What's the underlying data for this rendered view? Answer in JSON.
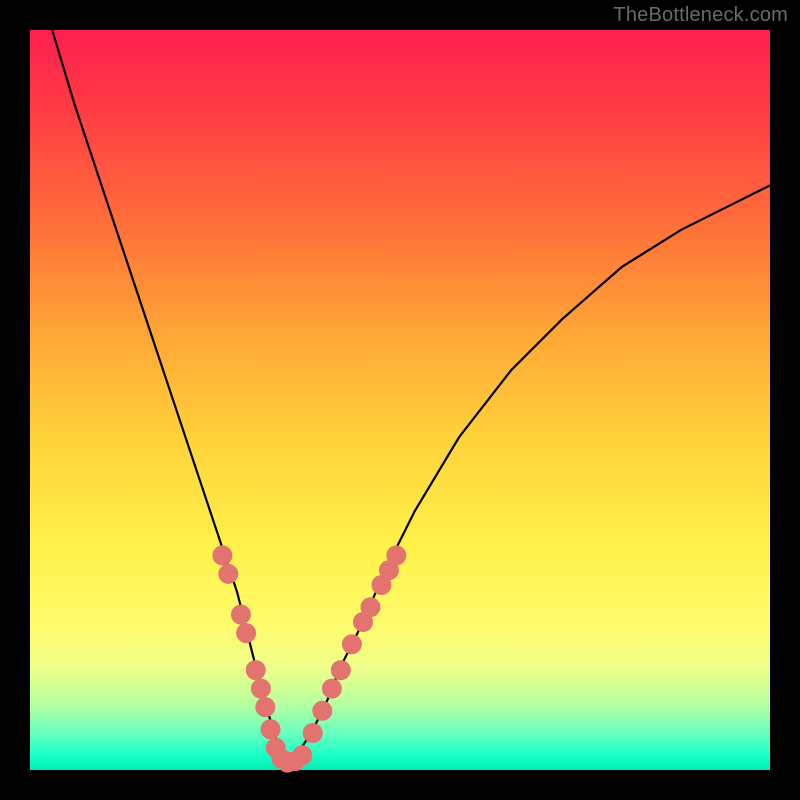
{
  "watermark": "TheBottleneck.com",
  "colors": {
    "marker": "#e2736f",
    "curve": "#000000",
    "frame": "#000000"
  },
  "chart_data": {
    "type": "line",
    "title": "",
    "xlabel": "",
    "ylabel": "",
    "xlim": [
      0,
      100
    ],
    "ylim": [
      0,
      100
    ],
    "grid": false,
    "legend": false,
    "series": [
      {
        "name": "bottleneck-curve",
        "x": [
          3,
          6,
          10,
          14,
          18,
          22,
          25,
          28,
          30,
          31.5,
          33,
          34,
          35,
          36,
          38,
          40,
          42,
          45,
          48,
          52,
          58,
          65,
          72,
          80,
          88,
          96,
          100
        ],
        "y": [
          100,
          90,
          78,
          66,
          54,
          42,
          33,
          24,
          16,
          10,
          5,
          2,
          0.8,
          2,
          5,
          9,
          14,
          20,
          27,
          35,
          45,
          54,
          61,
          68,
          73,
          77,
          79
        ]
      }
    ],
    "markers": [
      {
        "x": 26.0,
        "y": 29.0
      },
      {
        "x": 26.8,
        "y": 26.5
      },
      {
        "x": 28.5,
        "y": 21.0
      },
      {
        "x": 29.2,
        "y": 18.5
      },
      {
        "x": 30.5,
        "y": 13.5
      },
      {
        "x": 31.2,
        "y": 11.0
      },
      {
        "x": 31.8,
        "y": 8.5
      },
      {
        "x": 32.5,
        "y": 5.5
      },
      {
        "x": 33.2,
        "y": 3.0
      },
      {
        "x": 34.0,
        "y": 1.5
      },
      {
        "x": 34.8,
        "y": 1.0
      },
      {
        "x": 35.8,
        "y": 1.2
      },
      {
        "x": 36.8,
        "y": 2.0
      },
      {
        "x": 38.2,
        "y": 5.0
      },
      {
        "x": 39.5,
        "y": 8.0
      },
      {
        "x": 40.8,
        "y": 11.0
      },
      {
        "x": 42.0,
        "y": 13.5
      },
      {
        "x": 43.5,
        "y": 17.0
      },
      {
        "x": 45.0,
        "y": 20.0
      },
      {
        "x": 46.0,
        "y": 22.0
      },
      {
        "x": 47.5,
        "y": 25.0
      },
      {
        "x": 48.5,
        "y": 27.0
      },
      {
        "x": 49.5,
        "y": 29.0
      }
    ]
  }
}
